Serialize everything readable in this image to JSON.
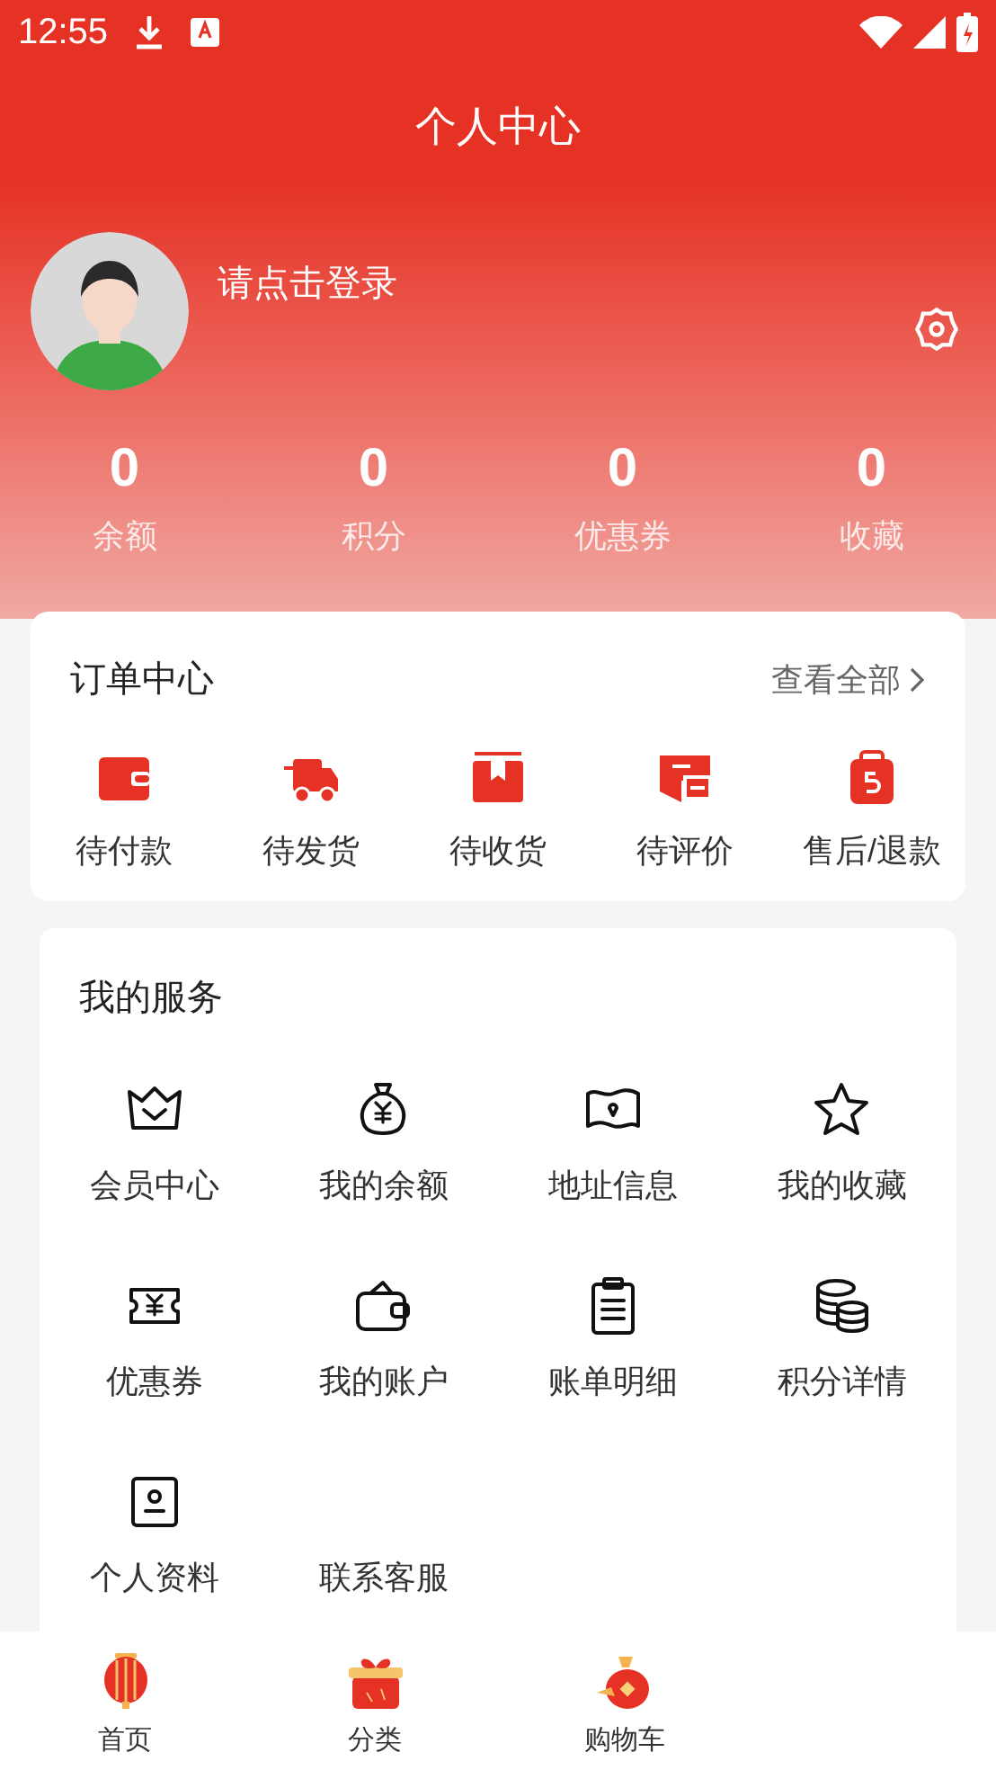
{
  "status_bar": {
    "time": "12:55"
  },
  "header": {
    "title": "个人中心"
  },
  "profile": {
    "login_prompt": "请点击登录"
  },
  "stats": [
    {
      "value": "0",
      "label": "余额"
    },
    {
      "value": "0",
      "label": "积分"
    },
    {
      "value": "0",
      "label": "优惠券"
    },
    {
      "value": "0",
      "label": "收藏"
    }
  ],
  "orders": {
    "title": "订单中心",
    "view_all": "查看全部",
    "items": [
      {
        "label": "待付款"
      },
      {
        "label": "待发货"
      },
      {
        "label": "待收货"
      },
      {
        "label": "待评价"
      },
      {
        "label": "售后/退款"
      }
    ]
  },
  "services": {
    "title": "我的服务",
    "items": [
      {
        "label": "会员中心"
      },
      {
        "label": "我的余额"
      },
      {
        "label": "地址信息"
      },
      {
        "label": "我的收藏"
      },
      {
        "label": "优惠券"
      },
      {
        "label": "我的账户"
      },
      {
        "label": "账单明细"
      },
      {
        "label": "积分详情"
      },
      {
        "label": "个人资料"
      },
      {
        "label": "联系客服"
      }
    ]
  },
  "tab_bar": [
    {
      "label": "首页"
    },
    {
      "label": "分类"
    },
    {
      "label": "购物车"
    }
  ]
}
